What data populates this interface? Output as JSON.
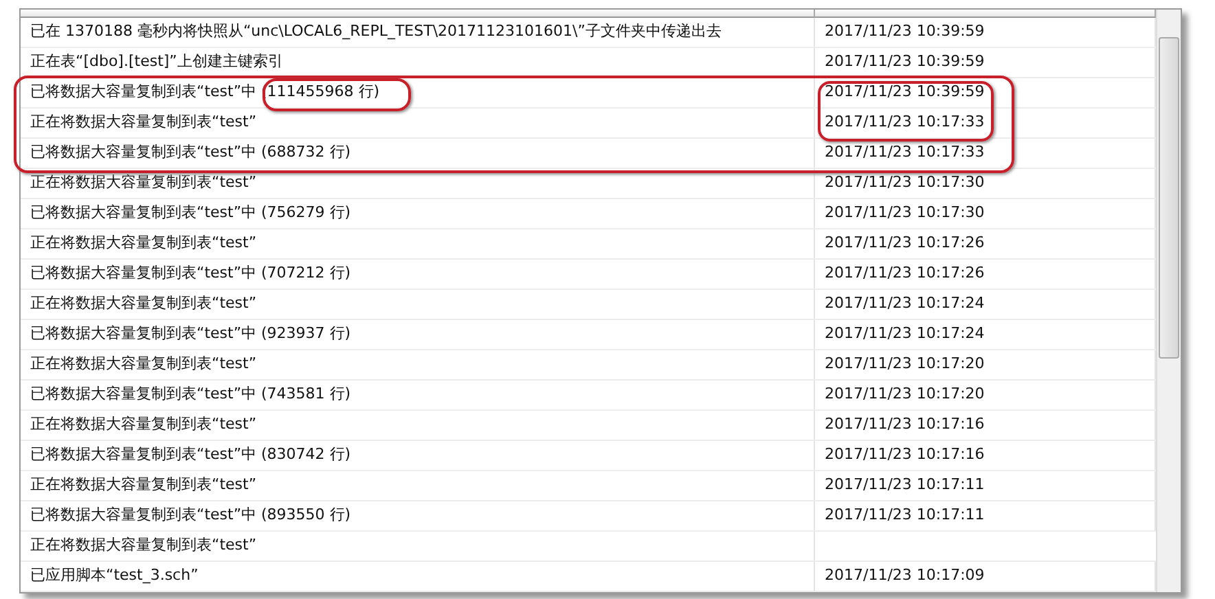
{
  "rows": [
    {
      "message": "已在 1370188 毫秒内将快照从“unc\\LOCAL6_REPL_TEST\\20171123101601\\”子文件夹中传递出去",
      "time": "2017/11/23 10:39:59"
    },
    {
      "message": "正在表“[dbo].[test]”上创建主键索引",
      "time": "2017/11/23 10:39:59"
    },
    {
      "message": "已将数据大容量复制到表“test”中 (111455968 行)",
      "time": "2017/11/23 10:39:59"
    },
    {
      "message": "正在将数据大容量复制到表“test”",
      "time": "2017/11/23 10:17:33"
    },
    {
      "message": "已将数据大容量复制到表“test”中 (688732 行)",
      "time": "2017/11/23 10:17:33"
    },
    {
      "message": "正在将数据大容量复制到表“test”",
      "time": "2017/11/23 10:17:30"
    },
    {
      "message": "已将数据大容量复制到表“test”中 (756279 行)",
      "time": "2017/11/23 10:17:30"
    },
    {
      "message": "正在将数据大容量复制到表“test”",
      "time": "2017/11/23 10:17:26"
    },
    {
      "message": "已将数据大容量复制到表“test”中 (707212 行)",
      "time": "2017/11/23 10:17:26"
    },
    {
      "message": "正在将数据大容量复制到表“test”",
      "time": "2017/11/23 10:17:24"
    },
    {
      "message": "已将数据大容量复制到表“test”中 (923937 行)",
      "time": "2017/11/23 10:17:24"
    },
    {
      "message": "正在将数据大容量复制到表“test”",
      "time": "2017/11/23 10:17:20"
    },
    {
      "message": "已将数据大容量复制到表“test”中 (743581 行)",
      "time": "2017/11/23 10:17:20"
    },
    {
      "message": "正在将数据大容量复制到表“test”",
      "time": "2017/11/23 10:17:16"
    },
    {
      "message": "已将数据大容量复制到表“test”中 (830742 行)",
      "time": "2017/11/23 10:17:16"
    },
    {
      "message": "正在将数据大容量复制到表“test”",
      "time": "2017/11/23 10:17:11"
    },
    {
      "message": "已将数据大容量复制到表“test”中 (893550 行)",
      "time": "2017/11/23 10:17:11"
    },
    {
      "message": "正在将数据大容量复制到表“test”"
    },
    {
      "message": "已应用脚本“test_3.sch”",
      "time": "2017/11/23 10:17:09"
    }
  ]
}
